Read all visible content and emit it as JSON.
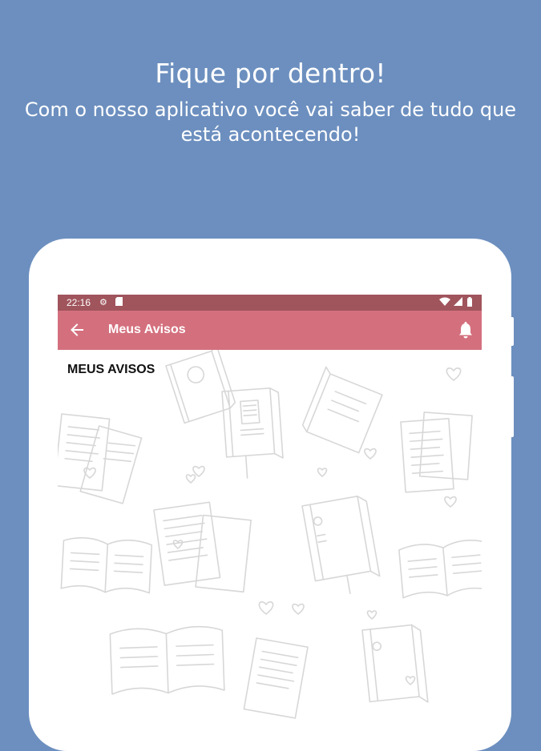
{
  "promo": {
    "headline": "Fique por dentro!",
    "subtitle": "Com o nosso aplicativo você vai saber de tudo que está acontecendo!"
  },
  "device": {
    "status_bar": {
      "time": "22:16",
      "left_icons": [
        "settings-icon",
        "sd-card-icon"
      ],
      "right_icons": [
        "wifi-icon",
        "signal-icon",
        "battery-icon"
      ]
    },
    "app_bar": {
      "back_icon": "arrow-back-icon",
      "title": "Meus Avisos",
      "action_icon": "bell-icon"
    },
    "content": {
      "section_title": "MEUS AVISOS"
    }
  },
  "colors": {
    "background": "#6c8fbf",
    "status_bar": "#a0545c",
    "app_bar": "#d4707e",
    "doodle_stroke": "#d7d7d7"
  }
}
